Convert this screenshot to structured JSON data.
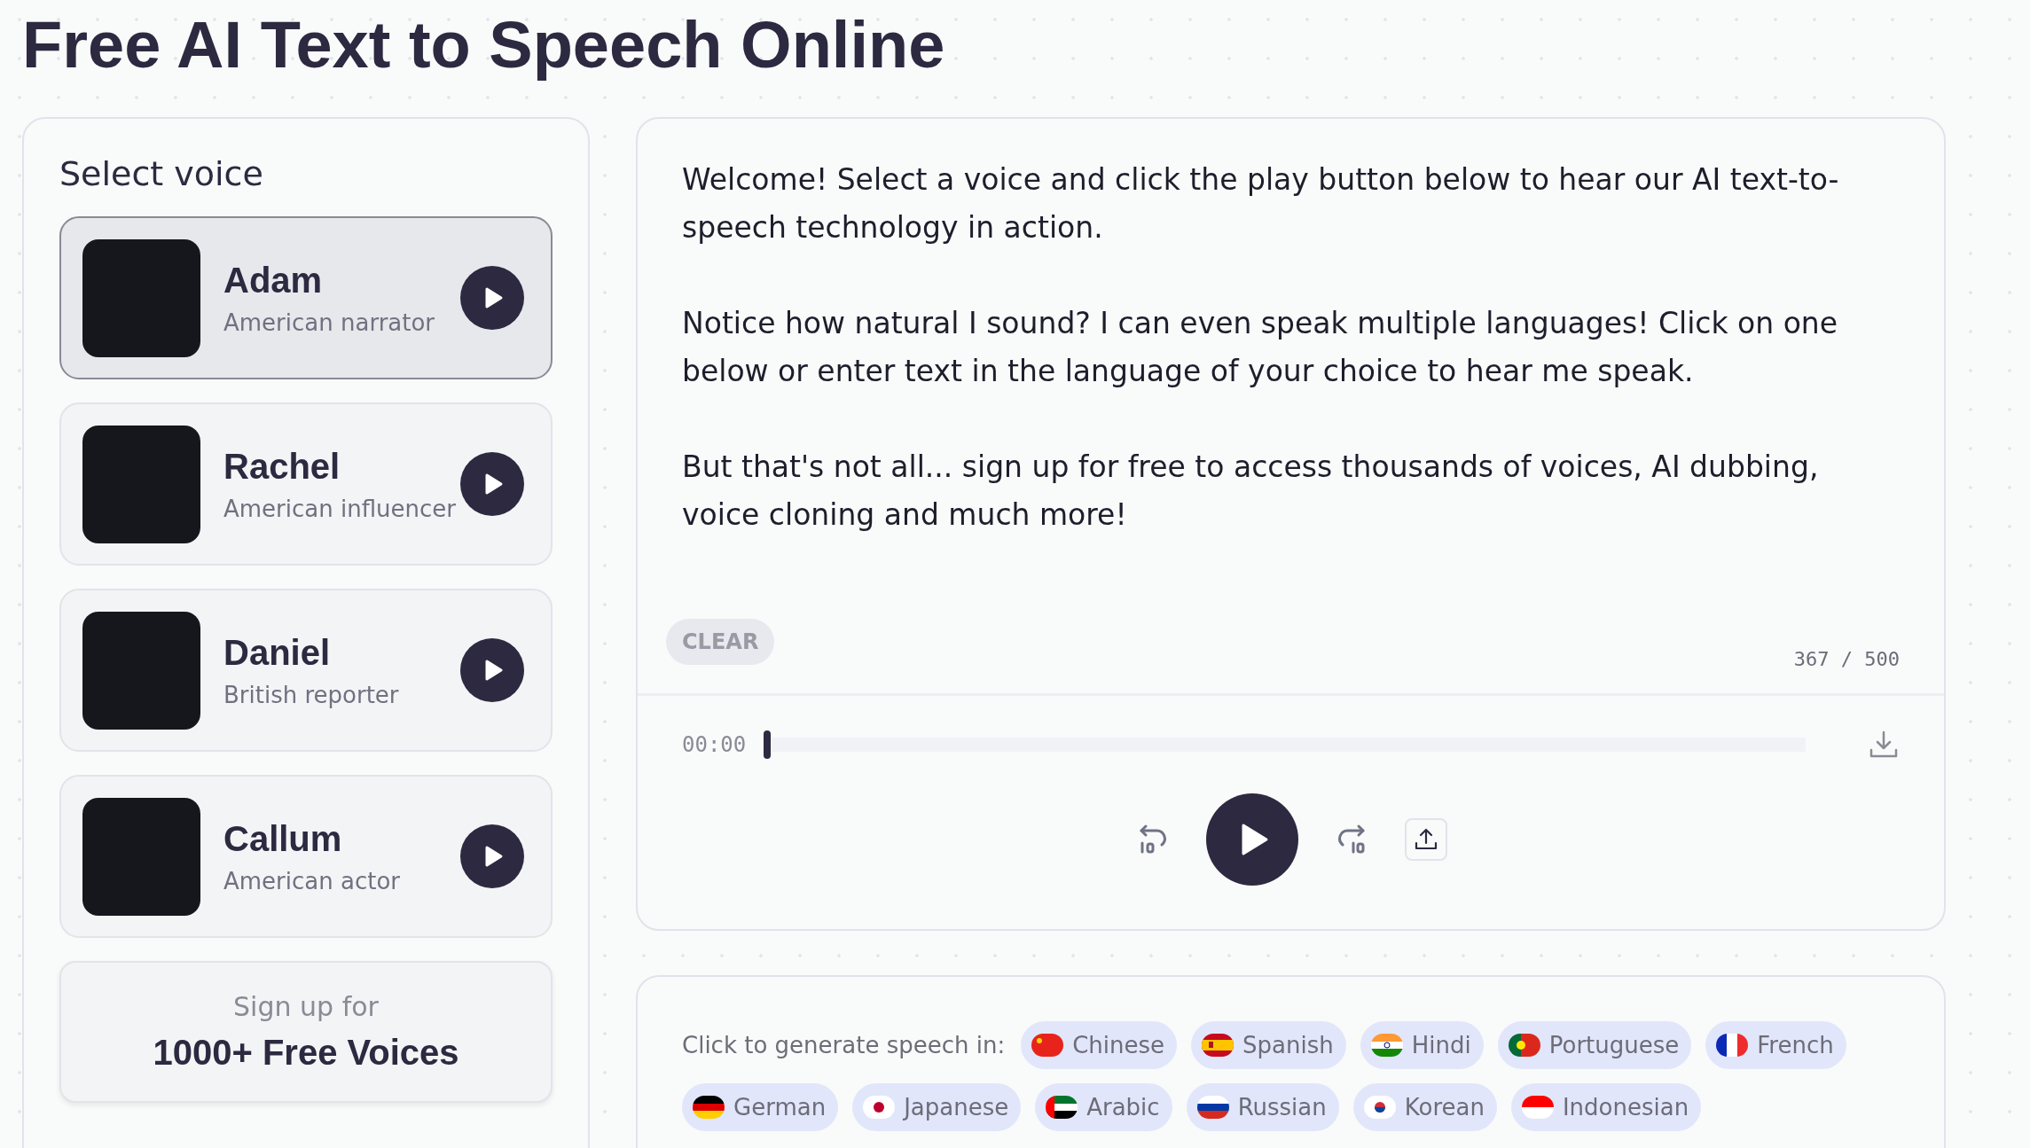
{
  "page_title": "Free AI Text to Speech Online",
  "voice_panel": {
    "heading": "Select voice",
    "voices": [
      {
        "name": "Adam",
        "description": "American narrator",
        "selected": true
      },
      {
        "name": "Rachel",
        "description": "American influencer",
        "selected": false
      },
      {
        "name": "Daniel",
        "description": "British reporter",
        "selected": false
      },
      {
        "name": "Callum",
        "description": "American actor",
        "selected": false
      }
    ],
    "signup": {
      "line_1": "Sign up for",
      "line_2": "1000+ Free Voices"
    }
  },
  "editor": {
    "text": "Welcome! Select a voice and click the play button below to hear our AI text-to-speech technology in action.\n\nNotice how natural I sound? I can even speak multiple languages! Click on one below or enter text in the language of your choice to hear me speak.\n\nBut that's not all... sign up for free to access thousands of voices, AI dubbing, voice cloning and much more!",
    "clear_button": "CLEAR",
    "char_count": "367 / 500"
  },
  "player": {
    "time": "00:00",
    "level": 0
  },
  "languages": {
    "label": "Click to generate speech in:",
    "items": [
      {
        "name": "Chinese"
      },
      {
        "name": "Spanish"
      },
      {
        "name": "Hindi"
      },
      {
        "name": "Portuguese"
      },
      {
        "name": "French"
      },
      {
        "name": "German"
      },
      {
        "name": "Japanese"
      },
      {
        "name": "Arabic"
      },
      {
        "name": "Russian"
      },
      {
        "name": "Korean"
      },
      {
        "name": "Indonesian"
      }
    ]
  }
}
